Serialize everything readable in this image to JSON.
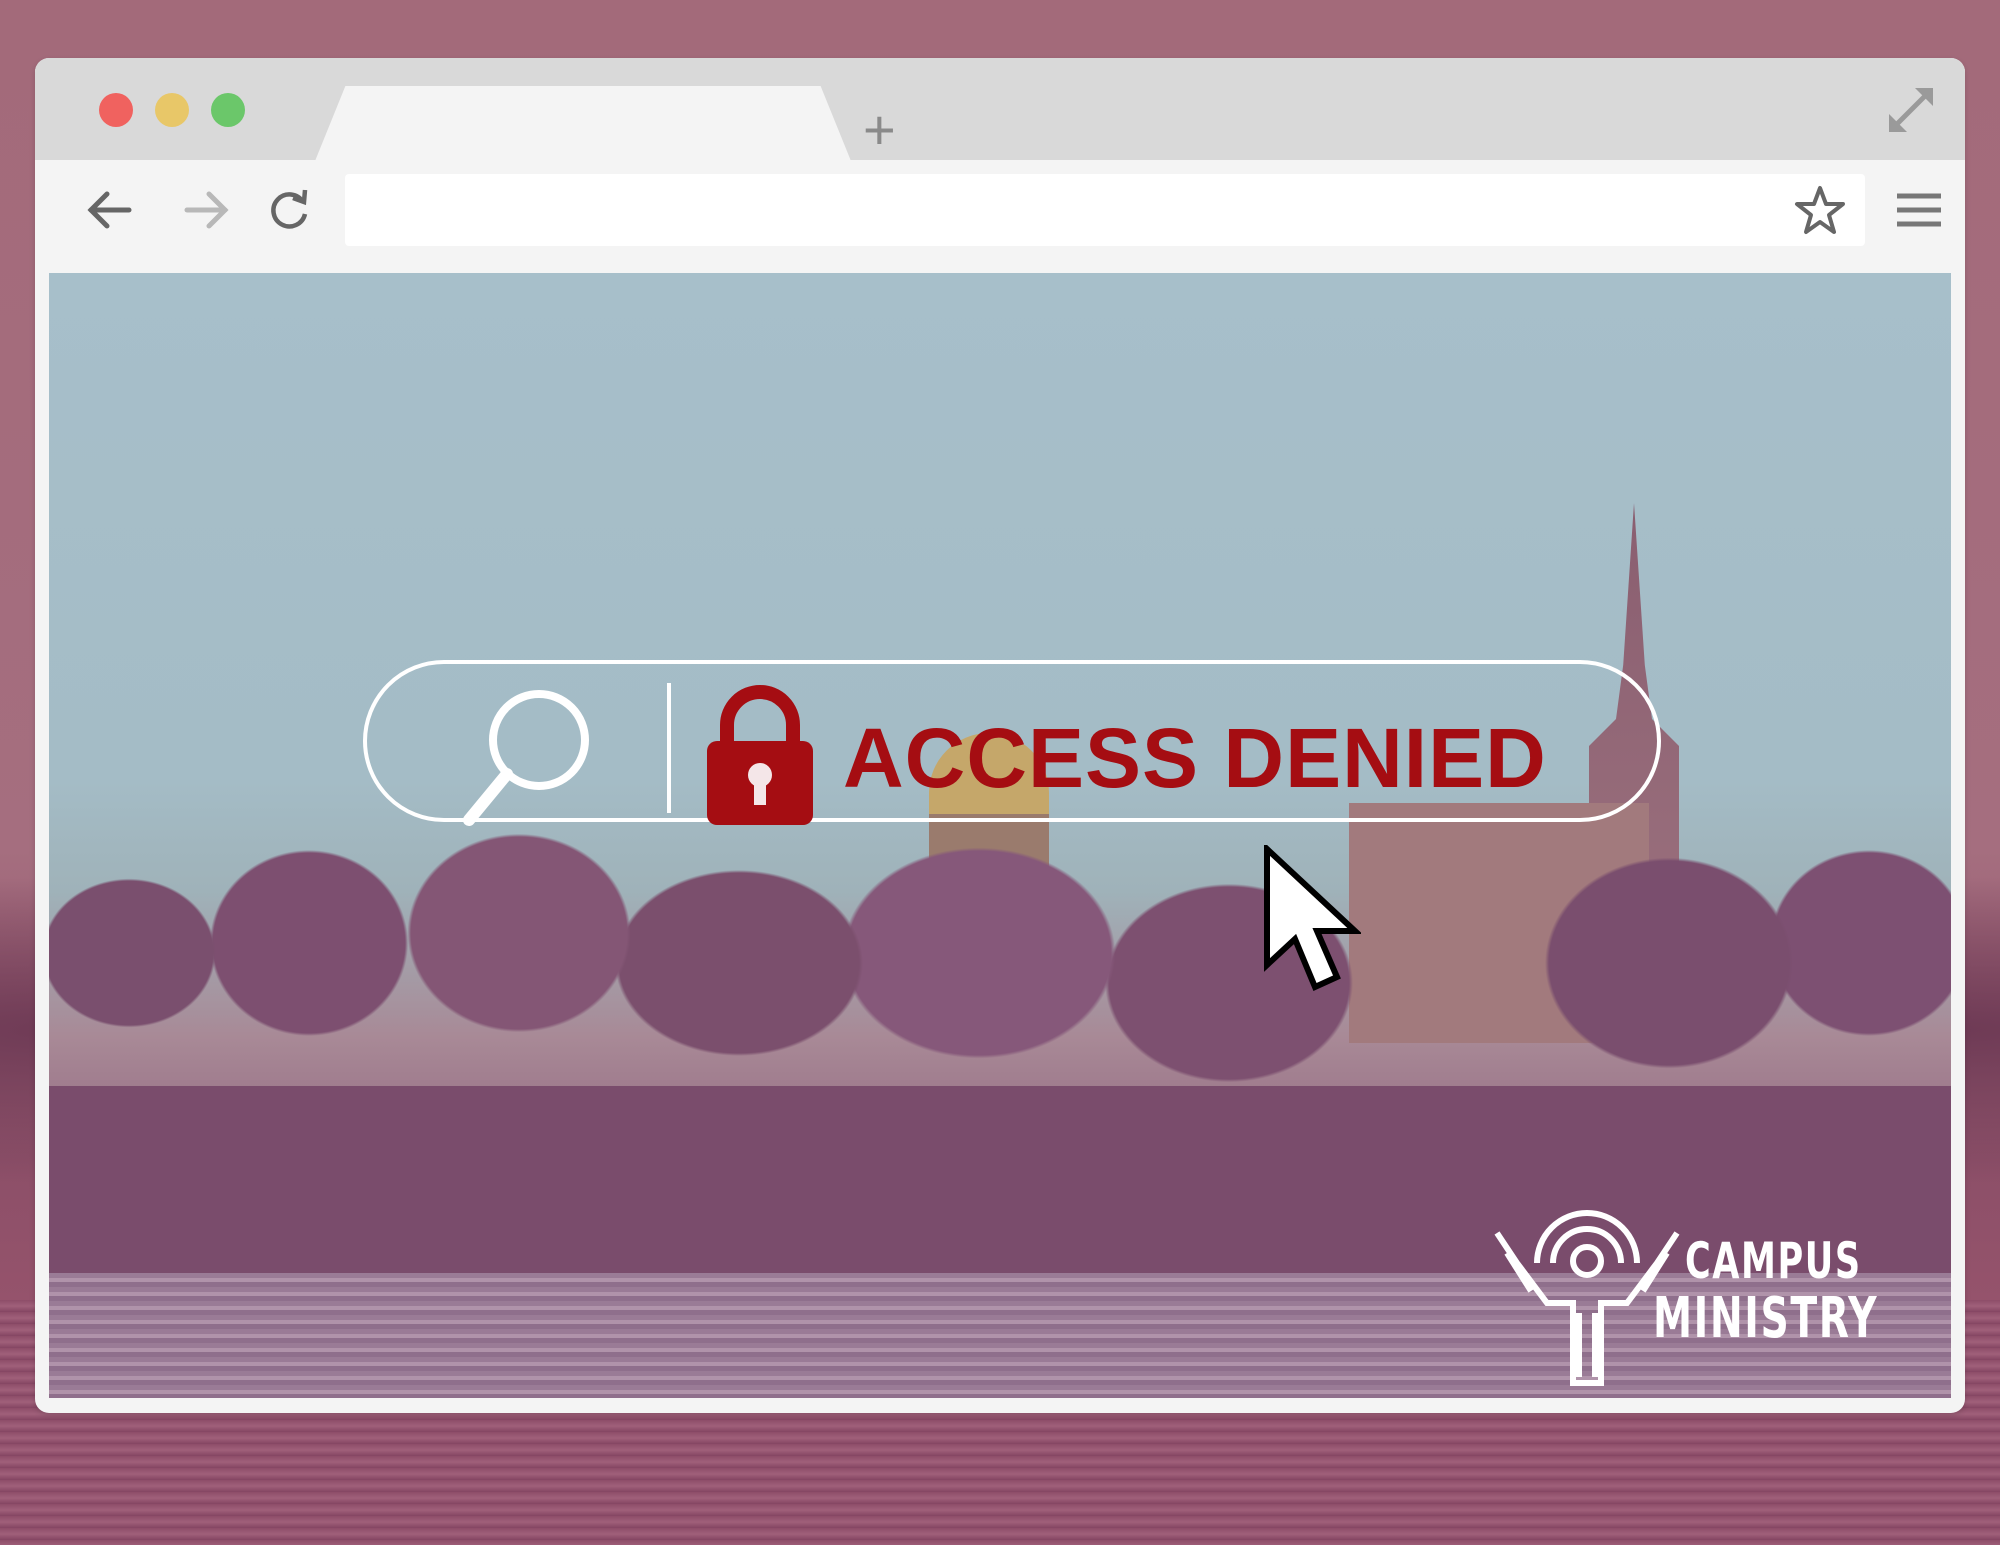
{
  "browser": {
    "traffic_lights": [
      "close",
      "minimize",
      "zoom"
    ],
    "new_tab_label": "+",
    "url_value": "",
    "icons": [
      "back-arrow-icon",
      "forward-arrow-icon",
      "reload-icon",
      "bookmark-star-icon",
      "hamburger-menu-icon",
      "expand-icon"
    ]
  },
  "content": {
    "message": "ACCESS DENIED",
    "logo": {
      "line1": "CAMPUS",
      "line2": "MINISTRY"
    }
  },
  "colors": {
    "accent_red": "#a50d12",
    "frame_tint": "#a36a7a",
    "white": "#ffffff"
  }
}
